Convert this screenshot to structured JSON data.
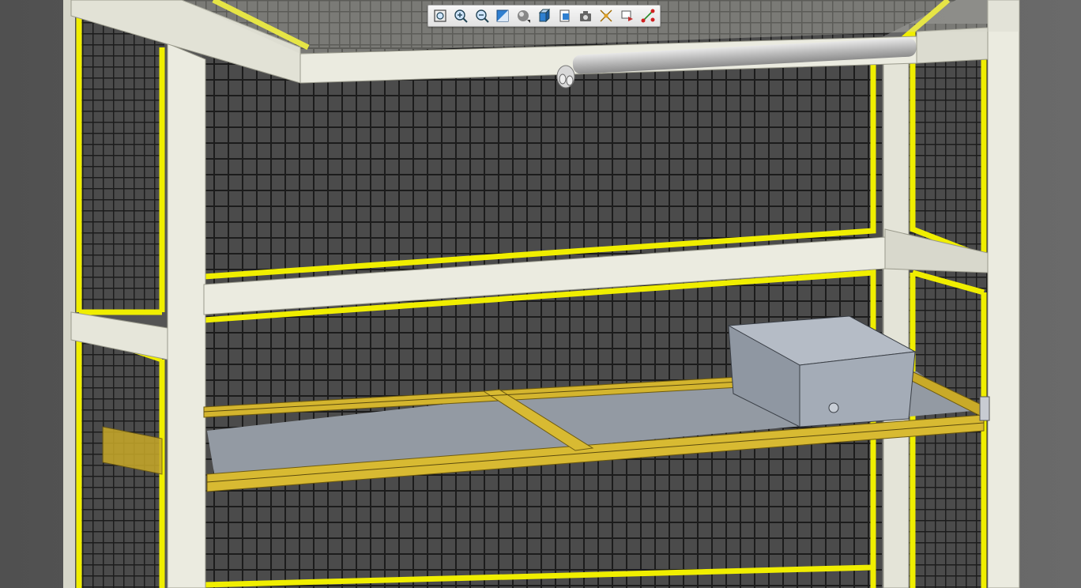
{
  "viewport": {
    "background": "#5c5c5c",
    "colors": {
      "frame_face": "#ebebe0",
      "frame_shade": "#c9c9bc",
      "panel_edge": "#f2f200",
      "mesh_back": "#4a4a4a",
      "mesh_wire": "#1f1f1f",
      "tray_bar": "#d8b830",
      "tray_floor": "#939aa3",
      "box_top": "#b5bcc6",
      "box_side": "#9aa2ad",
      "rod": "#bdbdbd"
    }
  },
  "toolbar": {
    "buttons": [
      {
        "name": "zoom-fit-icon"
      },
      {
        "name": "zoom-in-icon"
      },
      {
        "name": "zoom-out-icon"
      },
      {
        "name": "zoom-window-icon"
      },
      {
        "name": "render-style-icon"
      },
      {
        "name": "standard-view-icon"
      },
      {
        "name": "view-manager-icon"
      },
      {
        "name": "snapshot-icon"
      },
      {
        "name": "datum-display-icon"
      },
      {
        "name": "named-views-icon"
      },
      {
        "name": "spin-center-icon"
      }
    ]
  }
}
